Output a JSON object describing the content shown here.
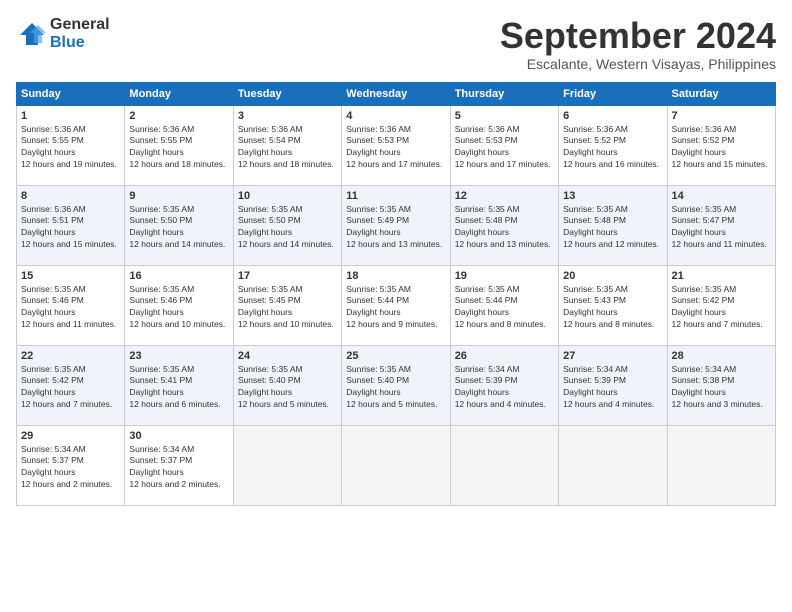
{
  "logo": {
    "line1": "General",
    "line2": "Blue"
  },
  "title": "September 2024",
  "location": "Escalante, Western Visayas, Philippines",
  "headers": [
    "Sunday",
    "Monday",
    "Tuesday",
    "Wednesday",
    "Thursday",
    "Friday",
    "Saturday"
  ],
  "weeks": [
    [
      {
        "day": "1",
        "sunrise": "5:36 AM",
        "sunset": "5:55 PM",
        "daylight": "12 hours and 19 minutes."
      },
      {
        "day": "2",
        "sunrise": "5:36 AM",
        "sunset": "5:55 PM",
        "daylight": "12 hours and 18 minutes."
      },
      {
        "day": "3",
        "sunrise": "5:36 AM",
        "sunset": "5:54 PM",
        "daylight": "12 hours and 18 minutes."
      },
      {
        "day": "4",
        "sunrise": "5:36 AM",
        "sunset": "5:53 PM",
        "daylight": "12 hours and 17 minutes."
      },
      {
        "day": "5",
        "sunrise": "5:36 AM",
        "sunset": "5:53 PM",
        "daylight": "12 hours and 17 minutes."
      },
      {
        "day": "6",
        "sunrise": "5:36 AM",
        "sunset": "5:52 PM",
        "daylight": "12 hours and 16 minutes."
      },
      {
        "day": "7",
        "sunrise": "5:36 AM",
        "sunset": "5:52 PM",
        "daylight": "12 hours and 15 minutes."
      }
    ],
    [
      {
        "day": "8",
        "sunrise": "5:36 AM",
        "sunset": "5:51 PM",
        "daylight": "12 hours and 15 minutes."
      },
      {
        "day": "9",
        "sunrise": "5:35 AM",
        "sunset": "5:50 PM",
        "daylight": "12 hours and 14 minutes."
      },
      {
        "day": "10",
        "sunrise": "5:35 AM",
        "sunset": "5:50 PM",
        "daylight": "12 hours and 14 minutes."
      },
      {
        "day": "11",
        "sunrise": "5:35 AM",
        "sunset": "5:49 PM",
        "daylight": "12 hours and 13 minutes."
      },
      {
        "day": "12",
        "sunrise": "5:35 AM",
        "sunset": "5:48 PM",
        "daylight": "12 hours and 13 minutes."
      },
      {
        "day": "13",
        "sunrise": "5:35 AM",
        "sunset": "5:48 PM",
        "daylight": "12 hours and 12 minutes."
      },
      {
        "day": "14",
        "sunrise": "5:35 AM",
        "sunset": "5:47 PM",
        "daylight": "12 hours and 11 minutes."
      }
    ],
    [
      {
        "day": "15",
        "sunrise": "5:35 AM",
        "sunset": "5:46 PM",
        "daylight": "12 hours and 11 minutes."
      },
      {
        "day": "16",
        "sunrise": "5:35 AM",
        "sunset": "5:46 PM",
        "daylight": "12 hours and 10 minutes."
      },
      {
        "day": "17",
        "sunrise": "5:35 AM",
        "sunset": "5:45 PM",
        "daylight": "12 hours and 10 minutes."
      },
      {
        "day": "18",
        "sunrise": "5:35 AM",
        "sunset": "5:44 PM",
        "daylight": "12 hours and 9 minutes."
      },
      {
        "day": "19",
        "sunrise": "5:35 AM",
        "sunset": "5:44 PM",
        "daylight": "12 hours and 8 minutes."
      },
      {
        "day": "20",
        "sunrise": "5:35 AM",
        "sunset": "5:43 PM",
        "daylight": "12 hours and 8 minutes."
      },
      {
        "day": "21",
        "sunrise": "5:35 AM",
        "sunset": "5:42 PM",
        "daylight": "12 hours and 7 minutes."
      }
    ],
    [
      {
        "day": "22",
        "sunrise": "5:35 AM",
        "sunset": "5:42 PM",
        "daylight": "12 hours and 7 minutes."
      },
      {
        "day": "23",
        "sunrise": "5:35 AM",
        "sunset": "5:41 PM",
        "daylight": "12 hours and 6 minutes."
      },
      {
        "day": "24",
        "sunrise": "5:35 AM",
        "sunset": "5:40 PM",
        "daylight": "12 hours and 5 minutes."
      },
      {
        "day": "25",
        "sunrise": "5:35 AM",
        "sunset": "5:40 PM",
        "daylight": "12 hours and 5 minutes."
      },
      {
        "day": "26",
        "sunrise": "5:34 AM",
        "sunset": "5:39 PM",
        "daylight": "12 hours and 4 minutes."
      },
      {
        "day": "27",
        "sunrise": "5:34 AM",
        "sunset": "5:39 PM",
        "daylight": "12 hours and 4 minutes."
      },
      {
        "day": "28",
        "sunrise": "5:34 AM",
        "sunset": "5:38 PM",
        "daylight": "12 hours and 3 minutes."
      }
    ],
    [
      {
        "day": "29",
        "sunrise": "5:34 AM",
        "sunset": "5:37 PM",
        "daylight": "12 hours and 2 minutes."
      },
      {
        "day": "30",
        "sunrise": "5:34 AM",
        "sunset": "5:37 PM",
        "daylight": "12 hours and 2 minutes."
      },
      null,
      null,
      null,
      null,
      null
    ]
  ]
}
